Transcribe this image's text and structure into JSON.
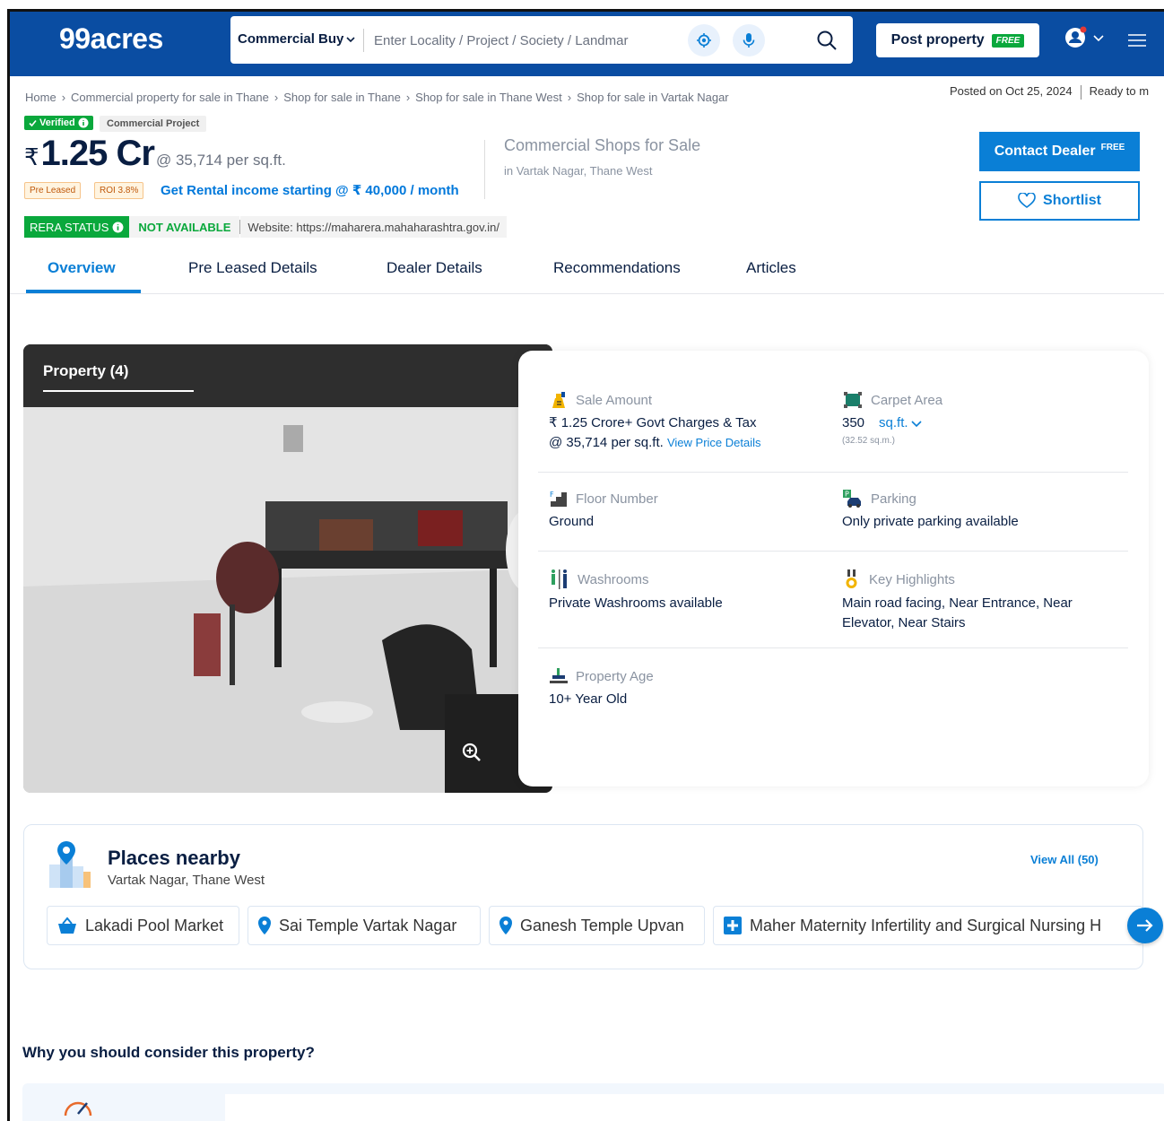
{
  "header": {
    "logo": "99acres",
    "search_type": "Commercial Buy",
    "search_placeholder": "Enter Locality / Project / Society / Landmar",
    "post_label": "Post property",
    "post_badge": "FREE"
  },
  "breadcrumb": [
    "Home",
    "Commercial property for sale in Thane",
    "Shop for sale in Thane",
    "Shop for sale in Thane West",
    "Shop for sale in Vartak Nagar"
  ],
  "posted": "Posted on Oct 25, 2024",
  "status": "Ready to m",
  "badges": {
    "verified": "Verified",
    "project": "Commercial Project"
  },
  "price": {
    "currency": "₹",
    "amount": "1.25 Cr",
    "rate": "@ 35,714 per sq.ft.",
    "tag1": "Pre Leased",
    "tag2": "ROI 3.8%",
    "rental": "Get Rental income starting @ ₹ 40,000 / month"
  },
  "listing": {
    "title": "Commercial Shops for Sale",
    "subtitle": "in Vartak Nagar, Thane West"
  },
  "actions": {
    "contact": "Contact Dealer",
    "contact_badge": "FREE",
    "shortlist": "Shortlist"
  },
  "rera": {
    "label": "RERA STATUS",
    "value": "NOT AVAILABLE",
    "website": "Website: https://maharera.mahaharashtra.gov.in/"
  },
  "tabs": [
    "Overview",
    "Pre Leased Details",
    "Dealer Details",
    "Recommendations",
    "Articles"
  ],
  "photo": {
    "title": "Property (4)"
  },
  "details": {
    "sale_amount": {
      "label": "Sale Amount",
      "line1": "₹ 1.25 Crore+ Govt Charges & Tax",
      "line2": "@ 35,714 per sq.ft.",
      "link": "View Price Details"
    },
    "carpet_area": {
      "label": "Carpet Area",
      "value": "350",
      "unit": "sq.ft.",
      "sub": "(32.52 sq.m.)"
    },
    "floor": {
      "label": "Floor Number",
      "value": "Ground"
    },
    "parking": {
      "label": "Parking",
      "value": "Only private parking available"
    },
    "washrooms": {
      "label": "Washrooms",
      "value": "Private Washrooms available"
    },
    "highlights": {
      "label": "Key Highlights",
      "line1": "Main road facing, Near Entrance, Near",
      "line2": "Elevator, Near Stairs"
    },
    "age": {
      "label": "Property Age",
      "value": "10+ Year Old"
    }
  },
  "places": {
    "title": "Places nearby",
    "subtitle": "Vartak Nagar, Thane West",
    "view_all": "View All (50)",
    "items": [
      "Lakadi Pool Market",
      "Sai Temple Vartak Nagar",
      "Ganesh Temple Upvan",
      "Maher Maternity Infertility and Surgical Nursing H"
    ]
  },
  "why": {
    "title": "Why you should consider this property?"
  },
  "colors": {
    "brand": "#0A4DA2",
    "accent": "#0A7FD6",
    "green": "#0AA83C"
  }
}
